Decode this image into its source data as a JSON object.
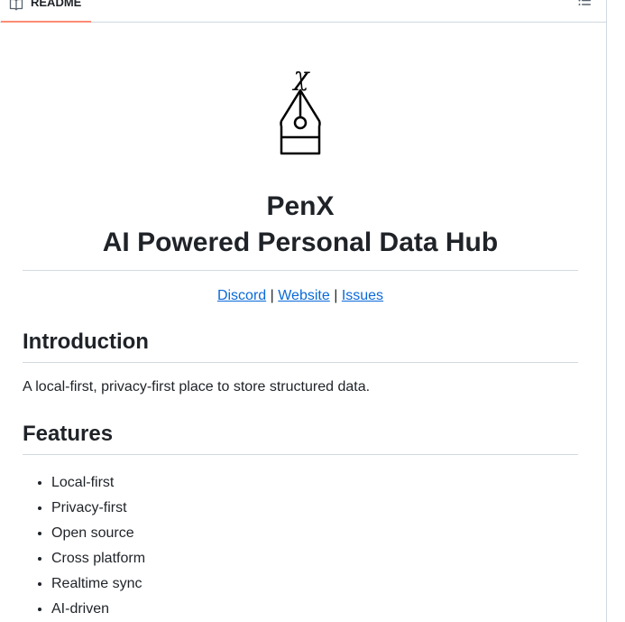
{
  "tabbar": {
    "readme_label": "README",
    "icons": {
      "readme": "book-icon",
      "toc": "list-unordered-icon"
    }
  },
  "logo": {
    "letter": "χ",
    "icon": "pen-nib-logo"
  },
  "header": {
    "title": "PenX",
    "subtitle": "AI Powered Personal Data Hub"
  },
  "links": {
    "discord": "Discord",
    "website": "Website",
    "issues": "Issues",
    "separator": "|"
  },
  "intro": {
    "heading": "Introduction",
    "text": "A local-first, privacy-first place to store structured data."
  },
  "features": {
    "heading": "Features",
    "items": [
      "Local-first",
      "Privacy-first",
      "Open source",
      "Cross platform",
      "Realtime sync",
      "AI-driven"
    ]
  },
  "colors": {
    "link": "#0969da",
    "tab_underline": "#fd8c73",
    "border": "#d1d9e0",
    "text": "#1f2328"
  }
}
